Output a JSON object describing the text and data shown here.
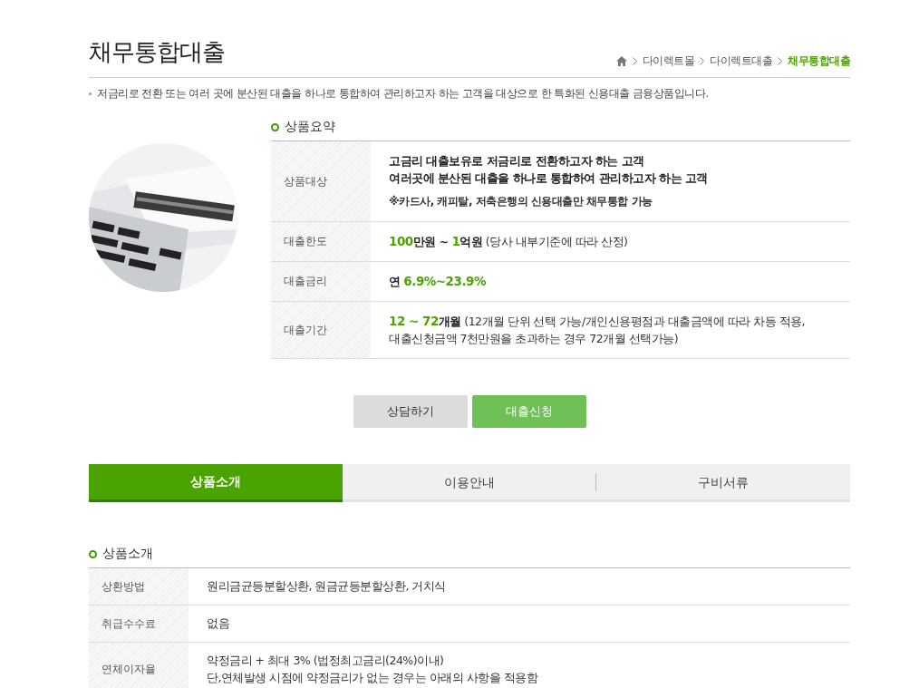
{
  "page_title": "채무통합대출",
  "breadcrumb": [
    {
      "label": "다이렉트몰",
      "selected": false
    },
    {
      "label": "다이렉트대출",
      "selected": false
    },
    {
      "label": "채무통합대출",
      "selected": true
    }
  ],
  "description": "저금리로 전환 또는 여러 곳에 분산된 대출을 하나로 통합하여 관리하고자 하는 고객을 대상으로 한 특화된 신용대출 금융상품입니다.",
  "summary": {
    "heading": "상품요약",
    "rows": [
      {
        "label": "상품대상",
        "lines": [
          [
            {
              "text": "고금리 대출보유로 저금리로 전환하고자 하는 고객",
              "kind": "bold"
            }
          ],
          [
            {
              "text": "여러곳에 분산된 대출을 하나로 통합하여 관리하고자 하는 고객",
              "kind": "bold"
            }
          ],
          [
            {
              "text": "※카드사, 캐피탈, 저축은행의 신용대출만 채무통합 가능",
              "kind": "note"
            }
          ]
        ]
      },
      {
        "label": "대출한도",
        "lines": [
          [
            {
              "text": "100",
              "kind": "green"
            },
            {
              "text": "만원 ~ ",
              "kind": "bold"
            },
            {
              "text": "1",
              "kind": "green"
            },
            {
              "text": "억원",
              "kind": "bold"
            },
            {
              "text": " (당사 내부기준에 따라 산정)",
              "kind": "plain"
            }
          ]
        ]
      },
      {
        "label": "대출금리",
        "lines": [
          [
            {
              "text": "연 ",
              "kind": "bold"
            },
            {
              "text": "6.9%~23.9%",
              "kind": "green"
            }
          ]
        ]
      },
      {
        "label": "대출기간",
        "lines": [
          [
            {
              "text": "12 ~ 72",
              "kind": "green"
            },
            {
              "text": "개월",
              "kind": "bold"
            },
            {
              "text": " (12개월 단위 선택 가능/개인신용평점과 대출금액에 따라 차등 적용,",
              "kind": "plain"
            }
          ],
          [
            {
              "text": "대출신청금액 7천만원을 초과하는 경우 72개월 선택가능)",
              "kind": "plain"
            }
          ]
        ]
      }
    ]
  },
  "buttons": [
    {
      "label": "상담하기",
      "kind": "secondary"
    },
    {
      "label": "대출신청",
      "kind": "primary"
    }
  ],
  "tabs": [
    {
      "label": "상품소개",
      "selected": true
    },
    {
      "label": "이용안내",
      "selected": false
    },
    {
      "label": "구비서류",
      "selected": false
    }
  ],
  "intro": {
    "heading": "상품소개",
    "rows": [
      {
        "label": "상환방법",
        "lines": [
          "원리금균등분할상환, 원금균등분할상환, 거치식"
        ]
      },
      {
        "label": "취급수수료",
        "lines": [
          "없음"
        ]
      },
      {
        "label": "연체이자율",
        "lines": [
          "약정금리 + 최대 3% (법정최고금리(24%)이내)",
          "단,연체발생 시점에 약정금리가 없는 경우는 아래의 사항을 적용함"
        ]
      }
    ]
  }
}
